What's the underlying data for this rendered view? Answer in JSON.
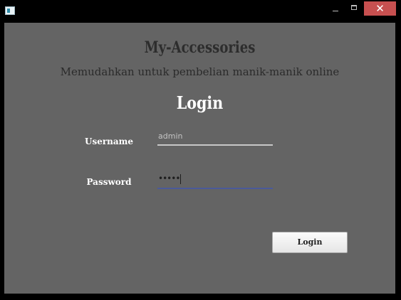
{
  "window": {
    "close_glyph": "✕",
    "minimize_icon": "minimize-icon",
    "maximize_icon": "maximize-icon",
    "app_icon": "app-icon"
  },
  "header": {
    "title": "My-Accessories",
    "subtitle": "Memudahkan untuk pembelian manik-manik online",
    "heading": "Login"
  },
  "form": {
    "username_label": "Username",
    "username_value": "admin",
    "password_label": "Password",
    "password_value": "•••••"
  },
  "actions": {
    "login_label": "Login"
  },
  "colors": {
    "background": "#646464",
    "close_button": "#c75050",
    "password_underline": "#4a5a9a"
  }
}
